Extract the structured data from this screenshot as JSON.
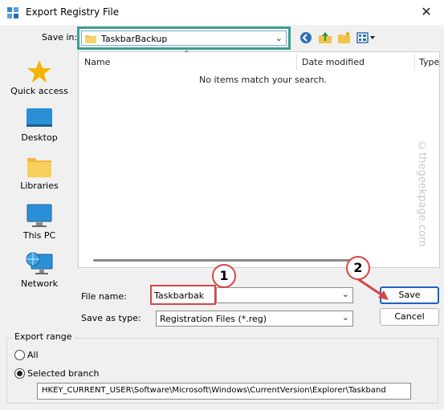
{
  "window": {
    "title": "Export Registry File",
    "close_glyph": "✕"
  },
  "toolbar": {
    "save_in_label": "Save in:",
    "save_in_value": "TaskbarBackup",
    "icons": [
      "back-icon",
      "up-folder-icon",
      "new-folder-icon",
      "view-menu-icon"
    ]
  },
  "places": [
    {
      "label": "Quick access",
      "icon": "star-icon"
    },
    {
      "label": "Desktop",
      "icon": "desktop-icon"
    },
    {
      "label": "Libraries",
      "icon": "libraries-icon"
    },
    {
      "label": "This PC",
      "icon": "this-pc-icon"
    },
    {
      "label": "Network",
      "icon": "network-icon"
    }
  ],
  "list": {
    "columns": [
      "Name",
      "Date modified",
      "Type"
    ],
    "empty_message": "No items match your search.",
    "watermark": "©thegeekpage.com"
  },
  "form": {
    "file_name_label": "File name:",
    "file_name_value": "Taskbarbak",
    "save_as_type_label": "Save as type:",
    "save_as_type_value": "Registration Files (*.reg)",
    "save_label": "Save",
    "cancel_label": "Cancel"
  },
  "annotations": {
    "step1": "1",
    "step2": "2"
  },
  "export_range": {
    "title": "Export range",
    "all_label": "All",
    "selected_label": "Selected branch",
    "selected_option": "Selected branch",
    "branch_value": "HKEY_CURRENT_USER\\Software\\Microsoft\\Windows\\CurrentVersion\\Explorer\\Taskband"
  },
  "colors": {
    "highlight_green": "#3a9d8f",
    "annotation_red": "#d94444",
    "default_button_blue": "#1b63c9"
  }
}
